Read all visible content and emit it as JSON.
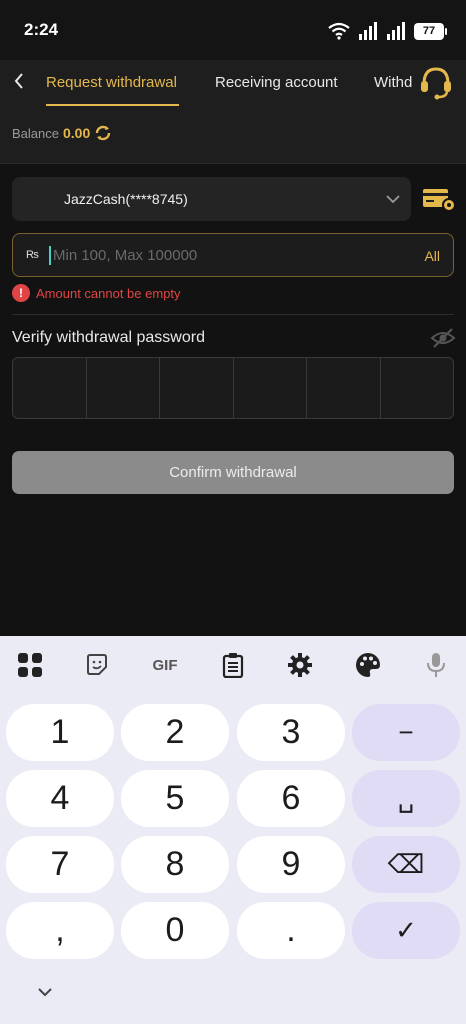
{
  "status_bar": {
    "time": "2:24",
    "battery": "77"
  },
  "header": {
    "tabs": [
      {
        "label": "Request withdrawal",
        "active": true
      },
      {
        "label": "Receiving account",
        "active": false
      },
      {
        "label": "Withd",
        "active": false
      }
    ],
    "balance_label": "Balance",
    "balance_value": "0.00"
  },
  "form": {
    "account_selected": "JazzCash(****8745)",
    "currency_symbol": "₨",
    "amount_placeholder": "Min 100, Max 100000",
    "all_label": "All",
    "error_text": "Amount cannot be empty",
    "password_label": "Verify withdrawal password",
    "confirm_label": "Confirm withdrawal"
  },
  "keyboard": {
    "toolbar": [
      "apps-icon",
      "sticker-icon",
      "GIF",
      "clipboard-icon",
      "settings-icon",
      "palette-icon",
      "mic-icon"
    ],
    "gif_label": "GIF",
    "keys": [
      "1",
      "2",
      "3",
      "−",
      "4",
      "5",
      "6",
      "␣",
      "7",
      "8",
      "9",
      "⌫",
      ",",
      "0",
      ".",
      "✓"
    ]
  },
  "colors": {
    "accent": "#e5b84c",
    "error": "#e04545",
    "background": "#121212",
    "keyboard": "#ebebf5"
  }
}
